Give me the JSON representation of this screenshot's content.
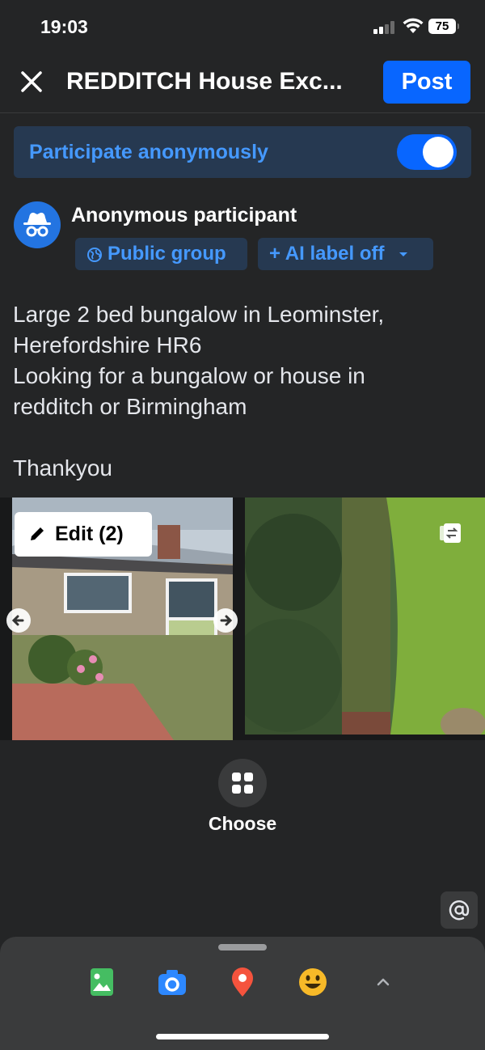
{
  "status_bar": {
    "time": "19:03",
    "battery": "75"
  },
  "header": {
    "title": "REDDITCH House Exc...",
    "post_label": "Post"
  },
  "anonymous": {
    "label": "Participate anonymously",
    "enabled": true
  },
  "author": {
    "name": "Anonymous participant",
    "audience_label": "Public group",
    "ai_label": "+ AI label off"
  },
  "post": {
    "lines": [
      "Large 2 bed bungalow in Leominster,",
      "Herefordshire HR6",
      "Looking for a bungalow or house in",
      "redditch or Birmingham",
      "",
      "Thankyou"
    ]
  },
  "media": {
    "edit_label": "Edit (2)"
  },
  "choose_label": "Choose",
  "tray": {
    "icons": [
      "photo-icon",
      "camera-icon",
      "location-pin-icon",
      "emoji-icon",
      "chevron-up-icon"
    ]
  },
  "colors": {
    "accent": "#0866ff",
    "chip_text": "#4599ff",
    "background": "#242526"
  }
}
